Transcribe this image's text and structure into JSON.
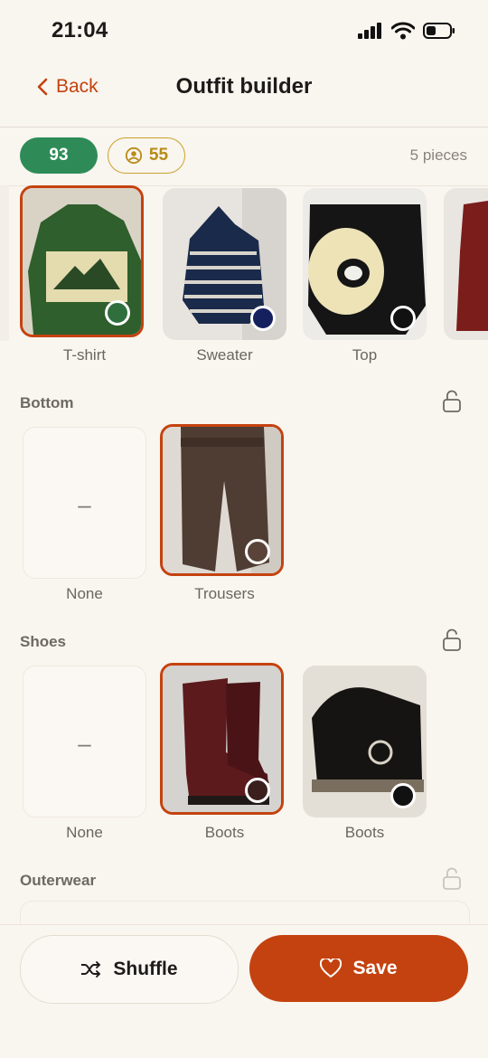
{
  "status": {
    "time": "21:04"
  },
  "nav": {
    "back_label": "Back",
    "title": "Outfit builder"
  },
  "summary": {
    "score": "93",
    "count": "55",
    "pieces": "5 pieces"
  },
  "tops": {
    "items": [
      {
        "label": "T-shirt",
        "radio_color": "#2f6f3e",
        "selected": true
      },
      {
        "label": "Sweater",
        "radio_color": "#15205e",
        "selected": false
      },
      {
        "label": "Top",
        "radio_color": "#111111",
        "selected": false
      }
    ]
  },
  "bottom": {
    "title": "Bottom",
    "items": [
      {
        "label": "None",
        "empty_mark": "–"
      },
      {
        "label": "Trousers",
        "radio_color": "#5a4338",
        "selected": true
      }
    ]
  },
  "shoes": {
    "title": "Shoes",
    "items": [
      {
        "label": "None",
        "empty_mark": "–"
      },
      {
        "label": "Boots",
        "radio_color": "#3a1f1d",
        "selected": true
      },
      {
        "label": "Boots",
        "radio_color": "#111111",
        "selected": false
      }
    ]
  },
  "outerwear": {
    "title": "Outerwear"
  },
  "actions": {
    "shuffle_label": "Shuffle",
    "save_label": "Save"
  },
  "colors": {
    "accent": "#c4420f",
    "score_green": "#2e8b57",
    "count_gold": "#c7a42d",
    "background": "#f9f5ef"
  }
}
